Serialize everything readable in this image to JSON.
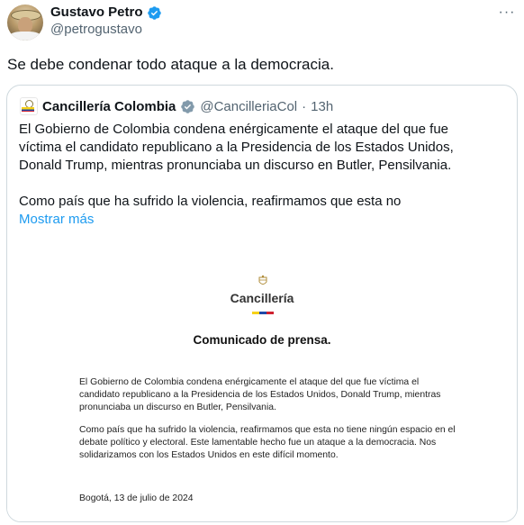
{
  "author": {
    "display_name": "Gustavo Petro",
    "handle": "@petrogustavo",
    "avatar_icon": "profile-photo",
    "verified_icon": "verified-badge-icon",
    "verified_color": "#1d9bf0"
  },
  "more_label": "···",
  "tweet_text": "Se debe condenar todo ataque a la democracia.",
  "quote": {
    "display_name": "Cancillería Colombia",
    "handle": "@CancilleriaCol",
    "separator": "·",
    "time": "13h",
    "text_p1_l1": "El Gobierno de Colombia condena enérgicamente el ataque del que fue",
    "text_p1_l2": "víctima el  candidato republicano a la Presidencia de los Estados Unidos,",
    "text_p1_l3": "Donald Trump, mientras pronunciaba un discurso en Butler, Pensilvania.",
    "text_p2": "Como país que ha sufrido la violencia, reafirmamos que esta no",
    "show_more": "Mostrar más"
  },
  "document": {
    "brand": "Cancillería",
    "title": "Comunicado de prensa.",
    "para1": "El Gobierno de Colombia condena enérgicamente el ataque del que fue víctima el candidato republicano a la Presidencia de los Estados Unidos, Donald Trump, mientras pronunciaba un discurso en Butler, Pensilvania.",
    "para2": "Como país que ha sufrido la violencia, reafirmamos que esta no tiene ningún espacio en el debate político y electoral. Este lamentable hecho fue un ataque a la democracia. Nos solidarizamos con los Estados Unidos en este difícil momento.",
    "date": "Bogotá, 13 de julio de 2024",
    "flag_colors": [
      "#f7d117",
      "#1f4aa8",
      "#cf2231"
    ]
  }
}
